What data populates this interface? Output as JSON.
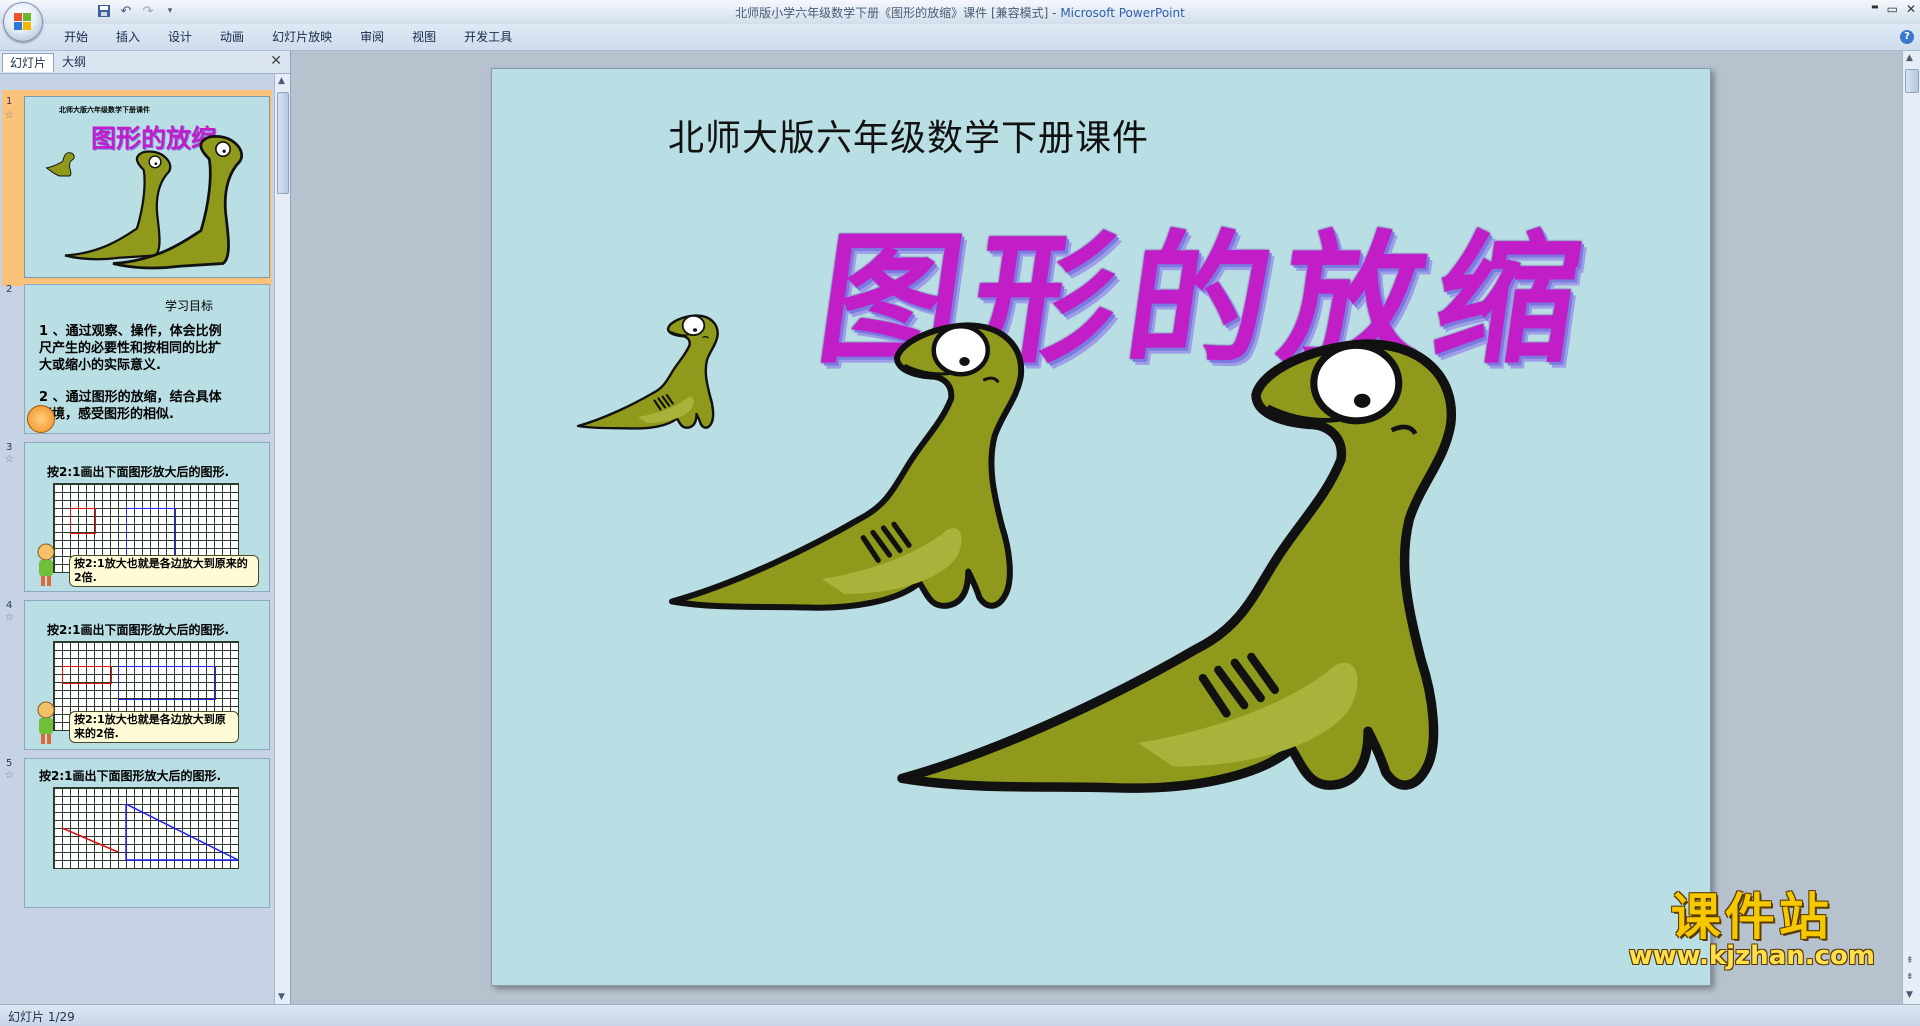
{
  "window": {
    "document_title": "北师版小学六年级数学下册《图形的放缩》课件 [兼容模式]",
    "separator": " - ",
    "app_name": "Microsoft PowerPoint",
    "minimize": "▬",
    "maximize": "▭",
    "close": "✕"
  },
  "ribbon": {
    "tabs": [
      "开始",
      "插入",
      "设计",
      "动画",
      "幻灯片放映",
      "审阅",
      "视图",
      "开发工具"
    ]
  },
  "left_pane": {
    "tab_slides": "幻灯片",
    "tab_outline": "大纲",
    "close": "✕",
    "thumbnails": [
      {
        "num": "1",
        "subtitle": "北师大版六年级数学下册课件",
        "title": "图形的放缩"
      },
      {
        "num": "2",
        "heading": "学习目标",
        "p1": "1 、通过观察、操作，体会比例尺产生的必要性和按相同的比扩大或缩小的实际意义.",
        "p2": "2 、通过图形的放缩，结合具体情境，感受图形的相似."
      },
      {
        "num": "3",
        "title": "按2:1画出下面图形放大后的图形.",
        "callout": "按2:1放大也就是各边放大到原来的2倍."
      },
      {
        "num": "4",
        "title": "按2:1画出下面图形放大后的图形.",
        "callout": "按2:1放大也就是各边放大到原来的2倍."
      },
      {
        "num": "5",
        "title": "按2:1画出下面图形放大后的图形."
      }
    ]
  },
  "slide": {
    "subtitle": "北师大版六年级数学下册课件",
    "title": "图形的放缩"
  },
  "watermark": {
    "top": "课件站",
    "bottom": "www.kjzhan.com"
  },
  "status": {
    "slide_counter": "幻灯片 1/29"
  },
  "colors": {
    "slide_bg": "#b9dfe5",
    "title_magenta": "#c21ec8",
    "dino_green": "#8f9a1c",
    "selection": "#f6a33d"
  }
}
